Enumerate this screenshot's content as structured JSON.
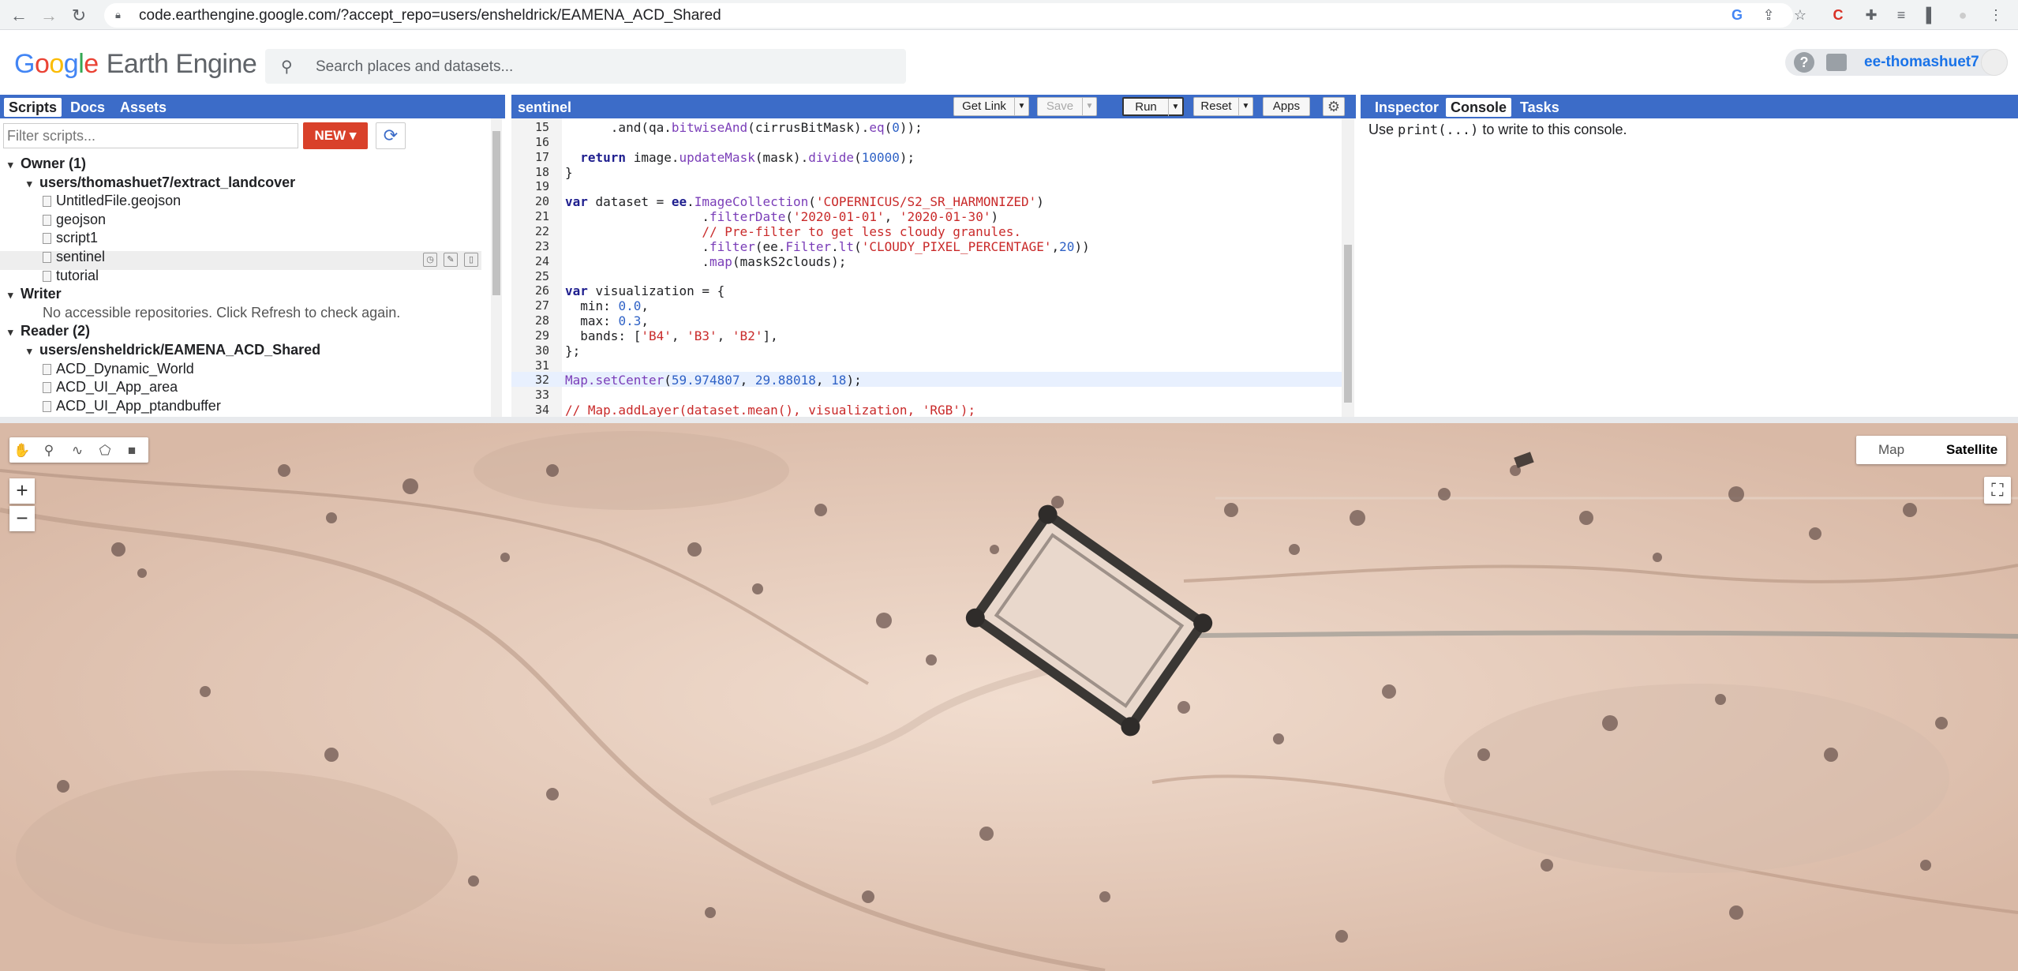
{
  "browser": {
    "url": "code.earthengine.google.com/?accept_repo=users/ensheldrick/EAMENA_ACD_Shared"
  },
  "header": {
    "logo_google": [
      "G",
      "o",
      "o",
      "g",
      "l",
      "e"
    ],
    "logo_product": "Earth Engine",
    "search_placeholder": "Search places and datasets...",
    "username": "ee-thomashuet7"
  },
  "left_panel": {
    "tabs": [
      "Scripts",
      "Docs",
      "Assets"
    ],
    "filter_placeholder": "Filter scripts...",
    "new_label": "NEW",
    "tree": [
      {
        "label": "Owner (1)",
        "level": 0,
        "bold": true,
        "caret": "▾"
      },
      {
        "label": "users/thomashuet7/extract_landcover",
        "level": 1,
        "bold": true,
        "caret": "▾"
      },
      {
        "label": "UntitledFile.geojson",
        "level": 2,
        "bold": false,
        "file": true
      },
      {
        "label": "geojson",
        "level": 2,
        "bold": false,
        "file": true
      },
      {
        "label": "script1",
        "level": 2,
        "bold": false,
        "file": true
      },
      {
        "label": "sentinel",
        "level": 2,
        "bold": false,
        "file": true,
        "selected": true
      },
      {
        "label": "tutorial",
        "level": 2,
        "bold": false,
        "file": true
      },
      {
        "label": "Writer",
        "level": 0,
        "bold": true,
        "caret": "▾"
      },
      {
        "label": "No accessible repositories. Click Refresh to check again.",
        "level": 1,
        "bold": false,
        "note": true
      },
      {
        "label": "Reader (2)",
        "level": 0,
        "bold": true,
        "caret": "▾"
      },
      {
        "label": "users/ensheldrick/EAMENA_ACD_Shared",
        "level": 1,
        "bold": true,
        "caret": "▾"
      },
      {
        "label": "ACD_Dynamic_World",
        "level": 2,
        "bold": false,
        "file": true
      },
      {
        "label": "ACD_UI_App_area",
        "level": 2,
        "bold": false,
        "file": true
      },
      {
        "label": "ACD_UI_App_ptandbuffer",
        "level": 2,
        "bold": false,
        "file": true
      }
    ]
  },
  "editor": {
    "script_name": "sentinel",
    "buttons": {
      "get_link": "Get Link",
      "save": "Save",
      "run": "Run",
      "reset": "Reset",
      "apps": "Apps"
    },
    "lines": [
      {
        "n": "15",
        "html": "      .and(qa.<span class=\"fn\">bitwiseAnd</span>(cirrusBitMask).<span class=\"fn\">eq</span>(<span class=\"num\">0</span>));"
      },
      {
        "n": "16",
        "html": ""
      },
      {
        "n": "17",
        "html": "  <span class=\"kw\">return</span> image.<span class=\"fn\">updateMask</span>(mask).<span class=\"fn\">divide</span>(<span class=\"num\">10000</span>);"
      },
      {
        "n": "18",
        "html": "}"
      },
      {
        "n": "19",
        "html": ""
      },
      {
        "n": "20",
        "html": "<span class=\"kw\">var</span> dataset = <span class=\"kw\">ee</span>.<span class=\"fn\">ImageCollection</span>(<span class=\"str\">'COPERNICUS/S2_SR_HARMONIZED'</span>)"
      },
      {
        "n": "21",
        "html": "                  .<span class=\"fn\">filterDate</span>(<span class=\"str\">'2020-01-01'</span>, <span class=\"str\">'2020-01-30'</span>)"
      },
      {
        "n": "22",
        "html": "                  <span class=\"cmt\">// Pre-filter to get less cloudy granules.</span>"
      },
      {
        "n": "23",
        "html": "                  .<span class=\"fn\">filter</span>(ee.<span class=\"fn\">Filter</span>.<span class=\"fn\">lt</span>(<span class=\"str\">'CLOUDY_PIXEL_PERCENTAGE'</span>,<span class=\"num\">20</span>))"
      },
      {
        "n": "24",
        "html": "                  .<span class=\"fn\">map</span>(maskS2clouds);"
      },
      {
        "n": "25",
        "html": ""
      },
      {
        "n": "26",
        "html": "<span class=\"kw\">var</span> visualization = {"
      },
      {
        "n": "27",
        "html": "  min: <span class=\"num\">0.0</span>,"
      },
      {
        "n": "28",
        "html": "  max: <span class=\"num\">0.3</span>,"
      },
      {
        "n": "29",
        "html": "  bands: [<span class=\"str\">'B4'</span>, <span class=\"str\">'B3'</span>, <span class=\"str\">'B2'</span>],"
      },
      {
        "n": "30",
        "html": "};"
      },
      {
        "n": "31",
        "html": ""
      },
      {
        "n": "32",
        "html": "<span class=\"fn\">Map.setCenter</span>(<span class=\"num\">59.974807</span>, <span class=\"num\">29.88018</span>, <span class=\"num\">18</span>);"
      },
      {
        "n": "33",
        "html": ""
      },
      {
        "n": "34",
        "html": "<span class=\"cmt\">// Map.addLayer(dataset.mean(), visualization, 'RGB');</span>"
      }
    ]
  },
  "right_panel": {
    "tabs": [
      "Inspector",
      "Console",
      "Tasks"
    ],
    "console_pre": "Use ",
    "console_code": "print(...)",
    "console_post": " to write to this console."
  },
  "map": {
    "zoom_in": "+",
    "zoom_out": "−",
    "type_map": "Map",
    "type_satellite": "Satellite"
  },
  "colors": {
    "accent": "#3c6cc8",
    "new_button": "#d9412a",
    "terrain": "#e4c7b4"
  }
}
